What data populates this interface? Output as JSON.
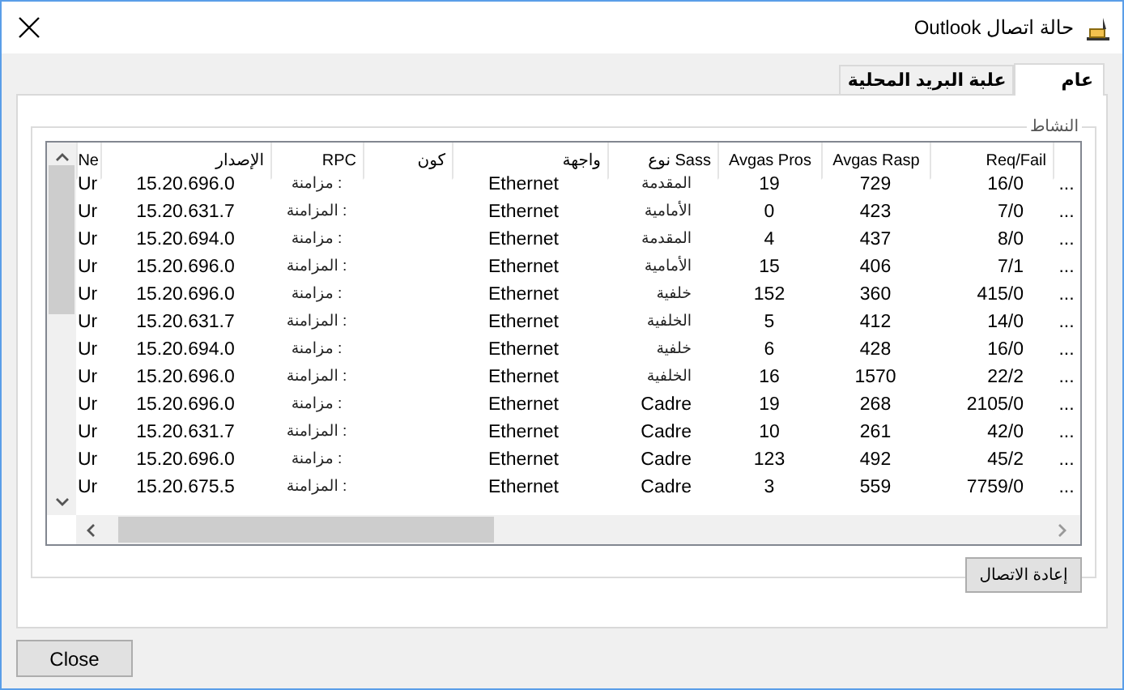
{
  "window": {
    "title": "حالة اتصال Outlook"
  },
  "tabs": [
    {
      "label": "عام",
      "selected": true
    },
    {
      "label": "علبة البريد المحلية",
      "selected": false
    }
  ],
  "group": {
    "title": "النشاط"
  },
  "table": {
    "columns": [
      "Ne",
      "الإصدار",
      "RPC",
      "كون",
      "واجهة",
      "نوع Sass",
      "Avgas Pros",
      "Avgas Rasp",
      "Req/Fail"
    ],
    "rows": [
      {
        "cells": [
          "Ur",
          "15.20.696.0",
          "مزامنة :",
          null,
          "Ethernet",
          "المقدمة",
          "19",
          "729",
          "16/0"
        ],
        "more": "..."
      },
      {
        "cells": [
          "Ur",
          "15.20.631.7",
          "المزامنة :",
          null,
          "Ethernet",
          "الأمامية",
          "0",
          "423",
          "7/0"
        ],
        "more": "..."
      },
      {
        "cells": [
          "Ur",
          "15.20.694.0",
          "مزامنة :",
          null,
          "Ethernet",
          "المقدمة",
          "4",
          "437",
          "8/0"
        ],
        "more": "..."
      },
      {
        "cells": [
          "Ur",
          "15.20.696.0",
          "المزامنة :",
          null,
          "Ethernet",
          "الأمامية",
          "15",
          "406",
          "7/1"
        ],
        "more": "..."
      },
      {
        "cells": [
          "Ur",
          "15.20.696.0",
          "مزامنة :",
          null,
          "Ethernet",
          "خلفية",
          "152",
          "360",
          "415/0"
        ],
        "more": "..."
      },
      {
        "cells": [
          "Ur",
          "15.20.631.7",
          "المزامنة :",
          null,
          "Ethernet",
          "الخلفية",
          "5",
          "412",
          "14/0"
        ],
        "more": "..."
      },
      {
        "cells": [
          "Ur",
          "15.20.694.0",
          "مزامنة :",
          null,
          "Ethernet",
          "خلفية",
          "6",
          "428",
          "16/0"
        ],
        "more": "..."
      },
      {
        "cells": [
          "Ur",
          "15.20.696.0",
          "المزامنة :",
          null,
          "Ethernet",
          "الخلفية",
          "16",
          "1570",
          "22/2"
        ],
        "more": "..."
      },
      {
        "cells": [
          "Ur",
          "15.20.696.0",
          "مزامنة :",
          null,
          "Ethernet",
          "Cadre",
          "19",
          "268",
          "2105/0"
        ],
        "more": "..."
      },
      {
        "cells": [
          "Ur",
          "15.20.631.7",
          "المزامنة :",
          null,
          "Ethernet",
          "Cadre",
          "10",
          "261",
          "42/0"
        ],
        "more": "..."
      },
      {
        "cells": [
          "Ur",
          "15.20.696.0",
          "مزامنة :",
          null,
          "Ethernet",
          "Cadre",
          "123",
          "492",
          "45/2"
        ],
        "more": "..."
      },
      {
        "cells": [
          "Ur",
          "15.20.675.5",
          "المزامنة :",
          null,
          "Ethernet",
          "Cadre",
          "3",
          "559",
          "7759/0"
        ],
        "more": "..."
      }
    ]
  },
  "reconnect_button": "إعادة الاتصال",
  "close_button": "Close"
}
